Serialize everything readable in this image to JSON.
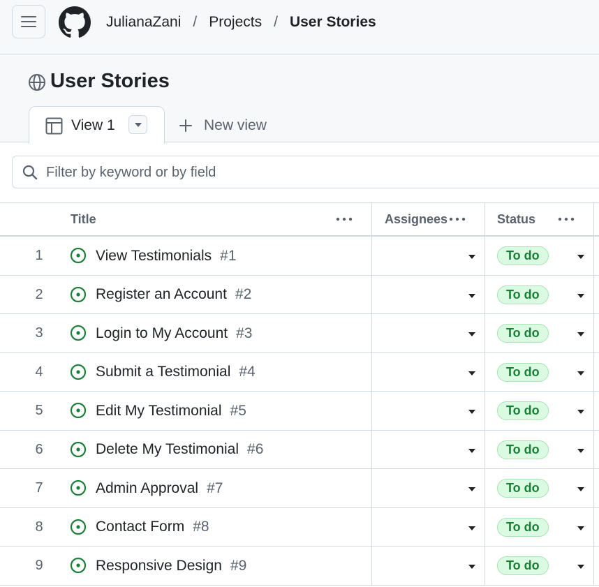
{
  "breadcrumb": {
    "owner": "JulianaZani",
    "section": "Projects",
    "current": "User Stories",
    "separator": "/"
  },
  "project": {
    "title": "User Stories",
    "visibility_icon": "globe-icon"
  },
  "tabs": {
    "active_label": "View 1",
    "new_view_label": "New view"
  },
  "filter": {
    "placeholder": "Filter by keyword or by field",
    "value": ""
  },
  "columns": [
    "Title",
    "Assignees",
    "Status"
  ],
  "rows": [
    {
      "n": "1",
      "title": "View Testimonials",
      "num": "#1",
      "status": "To do"
    },
    {
      "n": "2",
      "title": "Register an Account",
      "num": "#2",
      "status": "To do"
    },
    {
      "n": "3",
      "title": "Login to My Account",
      "num": "#3",
      "status": "To do"
    },
    {
      "n": "4",
      "title": "Submit a Testimonial",
      "num": "#4",
      "status": "To do"
    },
    {
      "n": "5",
      "title": "Edit My Testimonial",
      "num": "#5",
      "status": "To do"
    },
    {
      "n": "6",
      "title": "Delete My Testimonial",
      "num": "#6",
      "status": "To do"
    },
    {
      "n": "7",
      "title": "Admin Approval",
      "num": "#7",
      "status": "To do"
    },
    {
      "n": "8",
      "title": "Contact Form",
      "num": "#8",
      "status": "To do"
    },
    {
      "n": "9",
      "title": "Responsive Design",
      "num": "#9",
      "status": "To do"
    }
  ],
  "colors": {
    "open_issue": "#1a7f37",
    "status_bg": "#dafbe1",
    "status_text": "#1a7f37",
    "border": "#d1d9e0",
    "muted": "#59636e"
  }
}
